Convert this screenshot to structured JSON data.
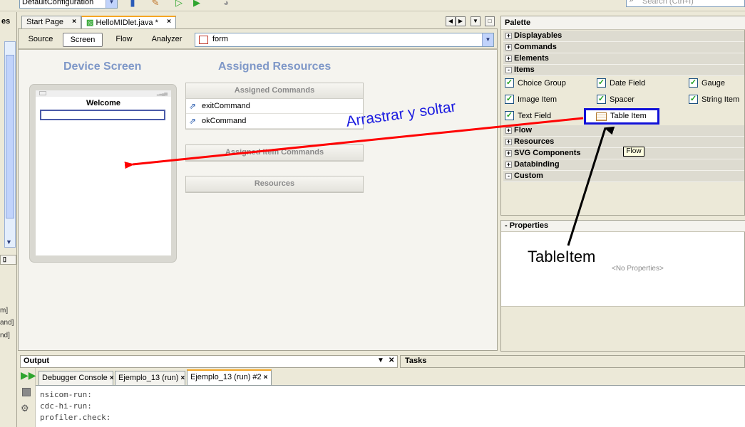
{
  "toolbar": {
    "config_value": "DefaultConfiguration",
    "search_placeholder": "Search (Ctrl+I)"
  },
  "left_panel": {
    "tab_label": "es",
    "clipped_lines": [
      "m]",
      "and]",
      "nd]"
    ]
  },
  "editor_tabs": [
    {
      "label": "Start Page",
      "close": "×"
    },
    {
      "label": "HelloMIDlet.java *",
      "close": "×"
    }
  ],
  "view_bar": {
    "buttons": [
      "Source",
      "Screen",
      "Flow",
      "Analyzer"
    ],
    "selected": "Screen",
    "form_value": "form"
  },
  "design": {
    "device_title": "Device Screen",
    "resources_title": "Assigned Resources",
    "phone_title": "Welcome",
    "assigned_commands": "Assigned Commands",
    "commands": [
      "exitCommand",
      "okCommand"
    ],
    "assigned_item_commands": "Assigned Item Commands",
    "resources": "Resources"
  },
  "palette": {
    "title": "Palette",
    "categories_top": [
      {
        "label": "Displayables",
        "state": "+"
      },
      {
        "label": "Commands",
        "state": "+"
      },
      {
        "label": "Elements",
        "state": "+"
      },
      {
        "label": "Items",
        "state": "-"
      }
    ],
    "items": [
      "Choice Group",
      "Date Field",
      "Gauge",
      "Image Item",
      "Spacer",
      "String Item",
      "Text Field"
    ],
    "highlighted_item": "Table Item",
    "categories_bottom": [
      {
        "label": "Flow",
        "state": "+"
      },
      {
        "label": "Resources",
        "state": "+"
      },
      {
        "label": "SVG Components",
        "state": "+"
      },
      {
        "label": "Databinding",
        "state": "+"
      },
      {
        "label": "Custom",
        "state": "-"
      }
    ],
    "tooltip": "Flow"
  },
  "properties": {
    "title": "- Properties",
    "empty_text": "<No Properties>"
  },
  "output": {
    "title": "Output",
    "tasks_title": "Tasks",
    "tabs": [
      {
        "label": "Debugger Console",
        "close": "×"
      },
      {
        "label": "Ejemplo_13 (run)",
        "close": "×"
      },
      {
        "label": "Ejemplo_13 (run) #2",
        "close": "×"
      }
    ],
    "lines": [
      "nsicom-run:",
      "cdc-hi-run:",
      "profiler.check:"
    ]
  },
  "annotations": {
    "drag_text": "Arrastrar y soltar",
    "table_text": "TableItem",
    "drag_arrow_color": "#ff0000",
    "highlight_color": "#1010d8"
  }
}
